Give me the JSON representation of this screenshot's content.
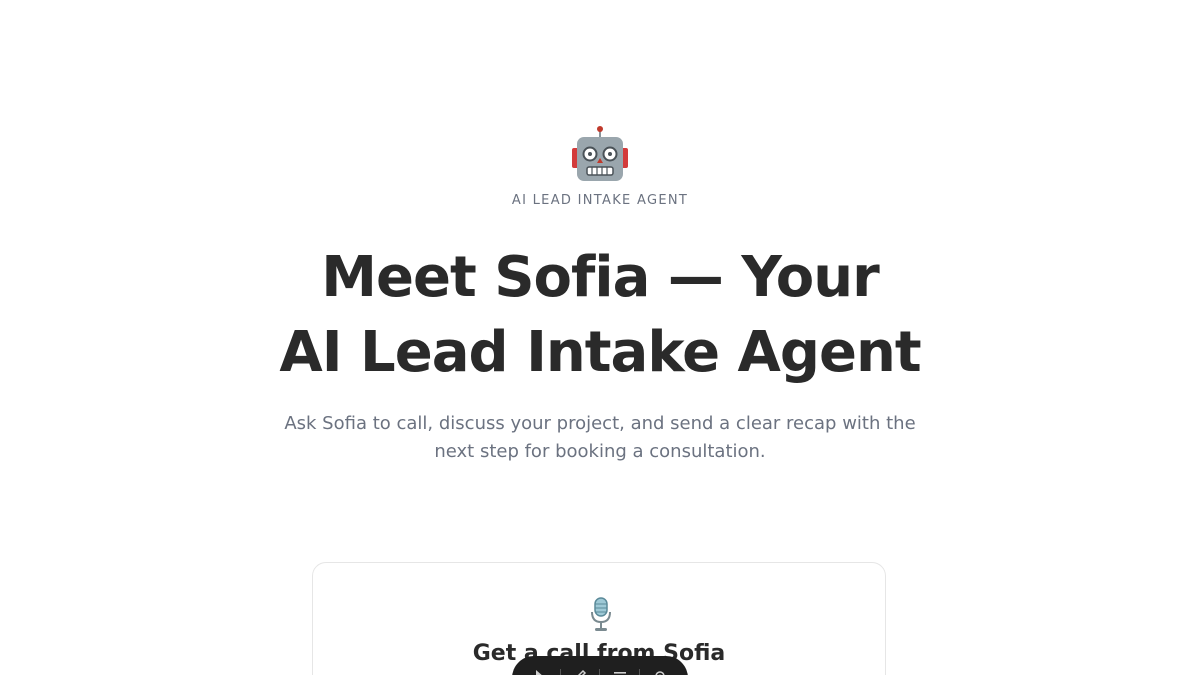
{
  "hero": {
    "icon": "robot-icon",
    "eyebrow": "AI LEAD INTAKE AGENT",
    "headline_line1": "Meet Sofia — Your",
    "headline_line2": "AI Lead Intake Agent",
    "subtitle": "Ask Sofia to call, discuss your project, and send a clear recap with the next step for booking a consultation."
  },
  "call_card": {
    "icon": "microphone-icon",
    "title": "Get a call from Sofia"
  },
  "toolbar": {
    "items": [
      "pointer-icon",
      "draw-icon",
      "menu-icon",
      "settings-icon"
    ]
  },
  "colors": {
    "text_dark": "#2a2a2a",
    "text_muted": "#6b7280",
    "card_border": "#e6e6e6",
    "toolbar_bg": "#1f1f1f"
  }
}
